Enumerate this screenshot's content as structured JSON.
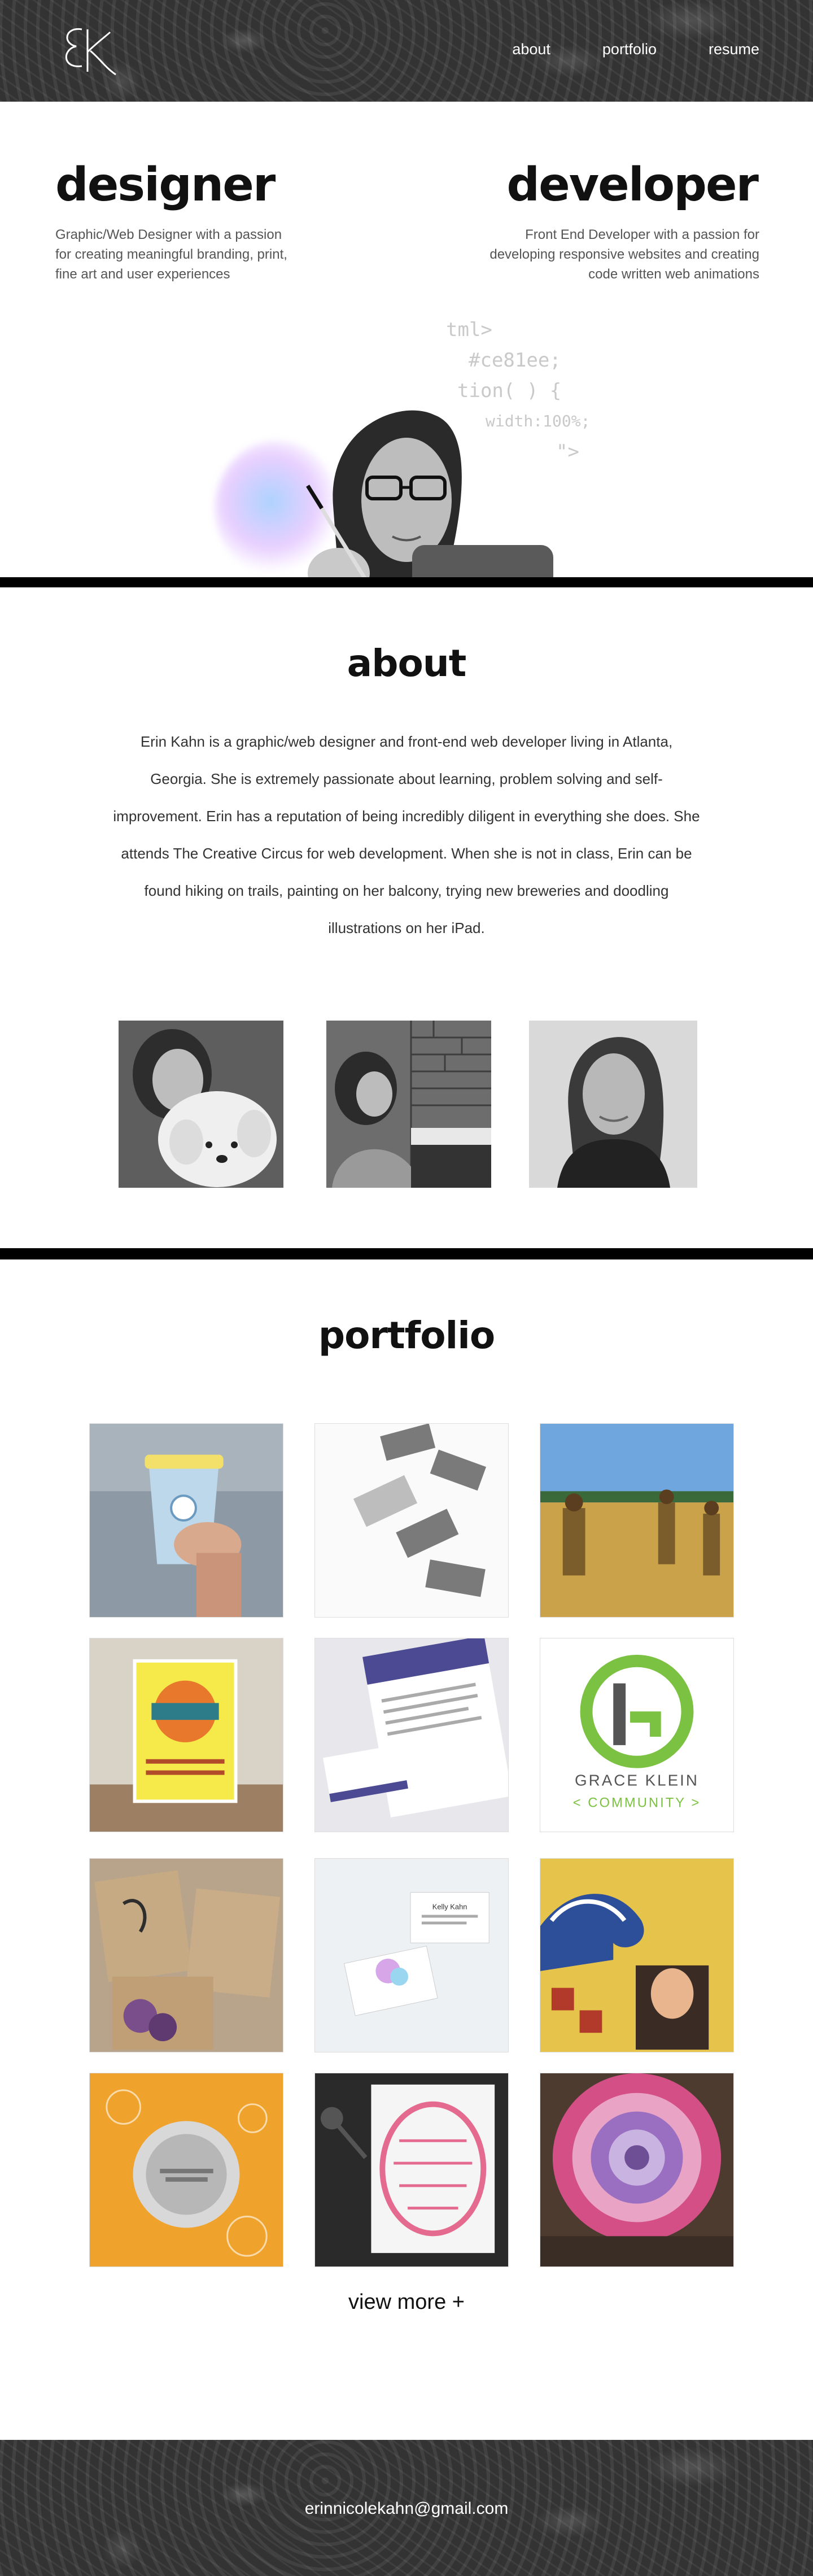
{
  "header": {
    "logo_text": "EK",
    "nav": [
      {
        "label": "about"
      },
      {
        "label": "portfolio"
      },
      {
        "label": "resume"
      }
    ]
  },
  "hero": {
    "designer_title": "designer",
    "designer_text": "Graphic/Web Designer with a passion for creating meaningful branding, print, fine art and user experiences",
    "developer_title": "developer",
    "developer_text": "Front End Developer with a passion for developing responsive websites and creating code written web animations",
    "code_lines": [
      "tml>",
      "#ce81ee;",
      "tion( ) {",
      "width:100%;",
      "\">"
    ]
  },
  "about": {
    "title": "about",
    "text": "Erin Kahn is a graphic/web designer and front-end web developer living in Atlanta, Georgia. She is extremely passionate about learning, problem solving and self-improvement.  Erin has a reputation of being incredibly diligent in everything she does. She attends The Creative Circus for web development. When she is not in class, Erin can be found hiking on trails, painting on her balcony, trying new breweries and doodling illustrations on her iPad."
  },
  "portfolio": {
    "title": "portfolio",
    "tiles": [
      {
        "name": "coffee-cup"
      },
      {
        "name": "business-cards-flying"
      },
      {
        "name": "wheat-field"
      },
      {
        "name": "eagles-wings-poster"
      },
      {
        "name": "marie-annette-stationery"
      },
      {
        "name": "grace-klein-logo",
        "label_main": "GRACE KLEIN",
        "label_sub": "< COMMUNITY >"
      },
      {
        "name": "clover-hill-packaging"
      },
      {
        "name": "kelly-kahn-cards",
        "card_name": "Kelly Kahn"
      },
      {
        "name": "great-wave-painting"
      },
      {
        "name": "orange-stamp-poster"
      },
      {
        "name": "lettering-print"
      },
      {
        "name": "flower-painting"
      }
    ],
    "view_more": "view more +"
  },
  "footer": {
    "email": "erinnicolekahn@gmail.com"
  },
  "colors": {
    "accent_green": "#7cc242",
    "dark_grey": "#333333",
    "black": "#000000"
  }
}
